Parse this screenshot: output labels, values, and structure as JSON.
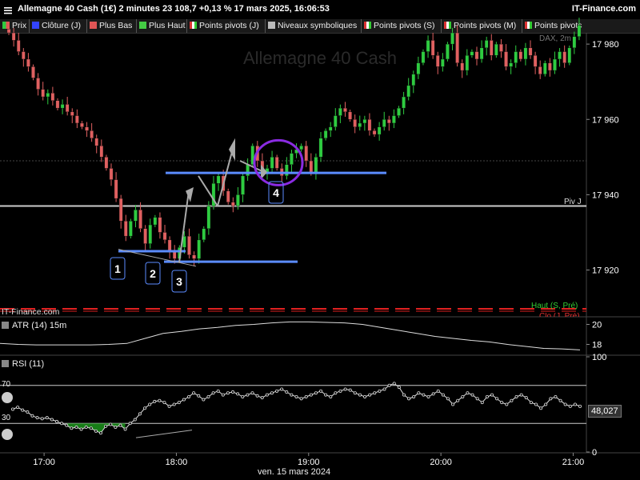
{
  "header": {
    "title": "Allemagne 40 Cash (1€) 2 minutes 23 108,7 +0,13 % 17 mars 2025, 16:06:53",
    "brand": "IT-Finance.com"
  },
  "legend": [
    {
      "label": "Prix",
      "color": "#2ecc40",
      "icon": "candle-icon"
    },
    {
      "label": "Clôture (J)",
      "color": "#3344ff",
      "icon": "square-icon"
    },
    {
      "label": "Plus Bas",
      "color": "#e05555",
      "icon": "square-icon"
    },
    {
      "label": "Plus Haut",
      "color": "#44cc44",
      "icon": "square-icon"
    },
    {
      "label": "Points pivots (J)",
      "color": "pivot",
      "icon": "pivot-icon"
    },
    {
      "label": "Niveaux symboliques",
      "color": "#bbbbbb",
      "icon": "square-icon"
    },
    {
      "label": "Points pivots (S)",
      "color": "pivot",
      "icon": "pivot-icon"
    },
    {
      "label": "Points pivots (M)",
      "color": "pivot",
      "icon": "pivot-icon"
    },
    {
      "label": "Points pivots",
      "color": "pivot",
      "icon": "pivot-icon"
    }
  ],
  "watermark": "Allemagne 40 Cash",
  "price_panel": {
    "instrument_tag": "DAX, 2m",
    "source_label": "IT-Finance.com",
    "pivot_label": "Piv J",
    "pivot_value": 17937,
    "haut_label": "Haut (S, Pré)",
    "clo_label": "Clo (J, Pré)",
    "annotations": [
      "1",
      "2",
      "3",
      "4"
    ],
    "colors": {
      "up": "#2ecc40",
      "down": "#e06060",
      "support": "#5b8cff",
      "pivot": "#cccccc",
      "circle": "#8a2be2",
      "dash": "#e02020"
    }
  },
  "atr_panel": {
    "label": "ATR (14) 15m"
  },
  "rsi_panel": {
    "label": "RSI (11)",
    "last_value": "48,027",
    "overbought": "70",
    "oversold": "30"
  },
  "xaxis": {
    "date_label": "ven. 15 mars 2024"
  },
  "chart_data": [
    {
      "type": "candlestick",
      "title": "Allemagne 40 Cash (1€) 2 minutes",
      "yticks": [
        17920,
        17940,
        17960,
        17980
      ],
      "ylim": [
        17908,
        17983
      ],
      "xticks": [
        "17:00",
        "18:00",
        "19:00",
        "20:00",
        "21:00"
      ],
      "x_range": [
        "16:40",
        "21:06"
      ],
      "candle_minutes": 2,
      "closes": [
        17983,
        17981,
        17978,
        17976,
        17974,
        17971,
        17968,
        17966,
        17967,
        17965,
        17963,
        17964,
        17962,
        17961,
        17959,
        17958,
        17957,
        17955,
        17953,
        17950,
        17947,
        17944,
        17939,
        17933,
        17929,
        17933,
        17936,
        17931,
        17927,
        17932,
        17934,
        17930,
        17928,
        17925,
        17923,
        17926,
        17929,
        17924,
        17923,
        17928,
        17931,
        17937,
        17943,
        17945,
        17941,
        17938,
        17937,
        17940,
        17945,
        17948,
        17953,
        17949,
        17946,
        17947,
        17950,
        17947,
        17945,
        17948,
        17951,
        17952,
        17953,
        17949,
        17946,
        17950,
        17955,
        17957,
        17958,
        17961,
        17963,
        17962,
        17960,
        17958,
        17959,
        17960,
        17957,
        17956,
        17958,
        17960,
        17959,
        17961,
        17963,
        17966,
        17969,
        17972,
        17975,
        17978,
        17981,
        17977,
        17974,
        17976,
        17980,
        17983,
        17975,
        17973,
        17977,
        17978,
        17976,
        17979,
        17981,
        17977,
        17980,
        17978,
        17974,
        17975,
        17978,
        17976,
        17979,
        17977,
        17974,
        17972,
        17975,
        17973,
        17976,
        17978,
        17975,
        17979,
        17982,
        17985
      ]
    },
    {
      "type": "line",
      "title": "ATR (14) 15m",
      "yticks": [
        18,
        20
      ],
      "ylim": [
        17,
        20.6
      ],
      "values": [
        18.1,
        18.0,
        17.95,
        17.95,
        17.95,
        17.95,
        18.0,
        18.1,
        18.6,
        19.1,
        19.3,
        19.55,
        19.7,
        19.9,
        20.0,
        20.15,
        20.25,
        20.25,
        20.2,
        20.15,
        20.0,
        19.7,
        19.4,
        19.1,
        18.8,
        18.6,
        18.4,
        18.25,
        18.0,
        17.8,
        17.6,
        17.55,
        17.45
      ]
    },
    {
      "type": "line",
      "title": "RSI (11)",
      "yticks": [
        0,
        100
      ],
      "ylim": [
        0,
        100
      ],
      "levels": [
        70,
        30
      ],
      "last_value": 48.027,
      "values": [
        45,
        47,
        44,
        42,
        38,
        36,
        35,
        36,
        34,
        32,
        30,
        28,
        25,
        26,
        24,
        26,
        25,
        22,
        20,
        27,
        29,
        26,
        28,
        24,
        30,
        34,
        40,
        46,
        50,
        53,
        54,
        52,
        48,
        50,
        52,
        55,
        58,
        62,
        59,
        55,
        58,
        62,
        64,
        60,
        62,
        63,
        61,
        58,
        60,
        62,
        59,
        57,
        60,
        62,
        64,
        66,
        63,
        60,
        58,
        56,
        58,
        60,
        62,
        64,
        60,
        58,
        62,
        64,
        66,
        65,
        62,
        60,
        58,
        60,
        62,
        64,
        66,
        70,
        72,
        68,
        60,
        56,
        58,
        62,
        60,
        58,
        61,
        64,
        60,
        56,
        50,
        54,
        58,
        62,
        60,
        56,
        52,
        58,
        60,
        56,
        52,
        50,
        54,
        58,
        60,
        57,
        52,
        50,
        46,
        50,
        56,
        58,
        54,
        50,
        48,
        50,
        48
      ]
    }
  ]
}
